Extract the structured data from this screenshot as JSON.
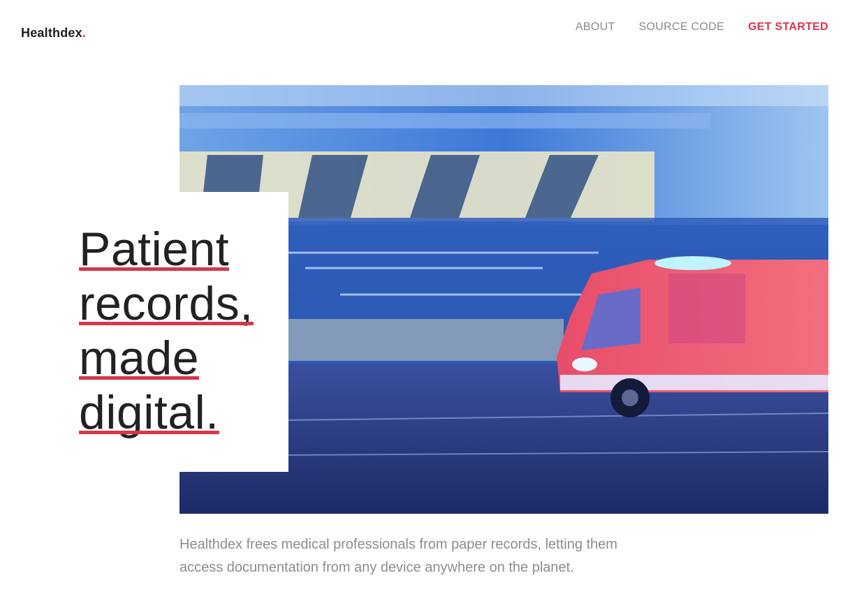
{
  "brand": {
    "name": "Healthdex",
    "dot": ".",
    "accent": "#d8364a"
  },
  "nav": {
    "about": "ABOUT",
    "source_code": "SOURCE CODE",
    "get_started": "GET STARTED"
  },
  "hero": {
    "image_icon": "ambulance-motion-photo",
    "headline_lines": [
      "Patient",
      "records,",
      "made",
      "digital."
    ],
    "description": "Healthdex frees medical professionals from paper records, letting them access documentation from any device anywhere on the planet."
  }
}
